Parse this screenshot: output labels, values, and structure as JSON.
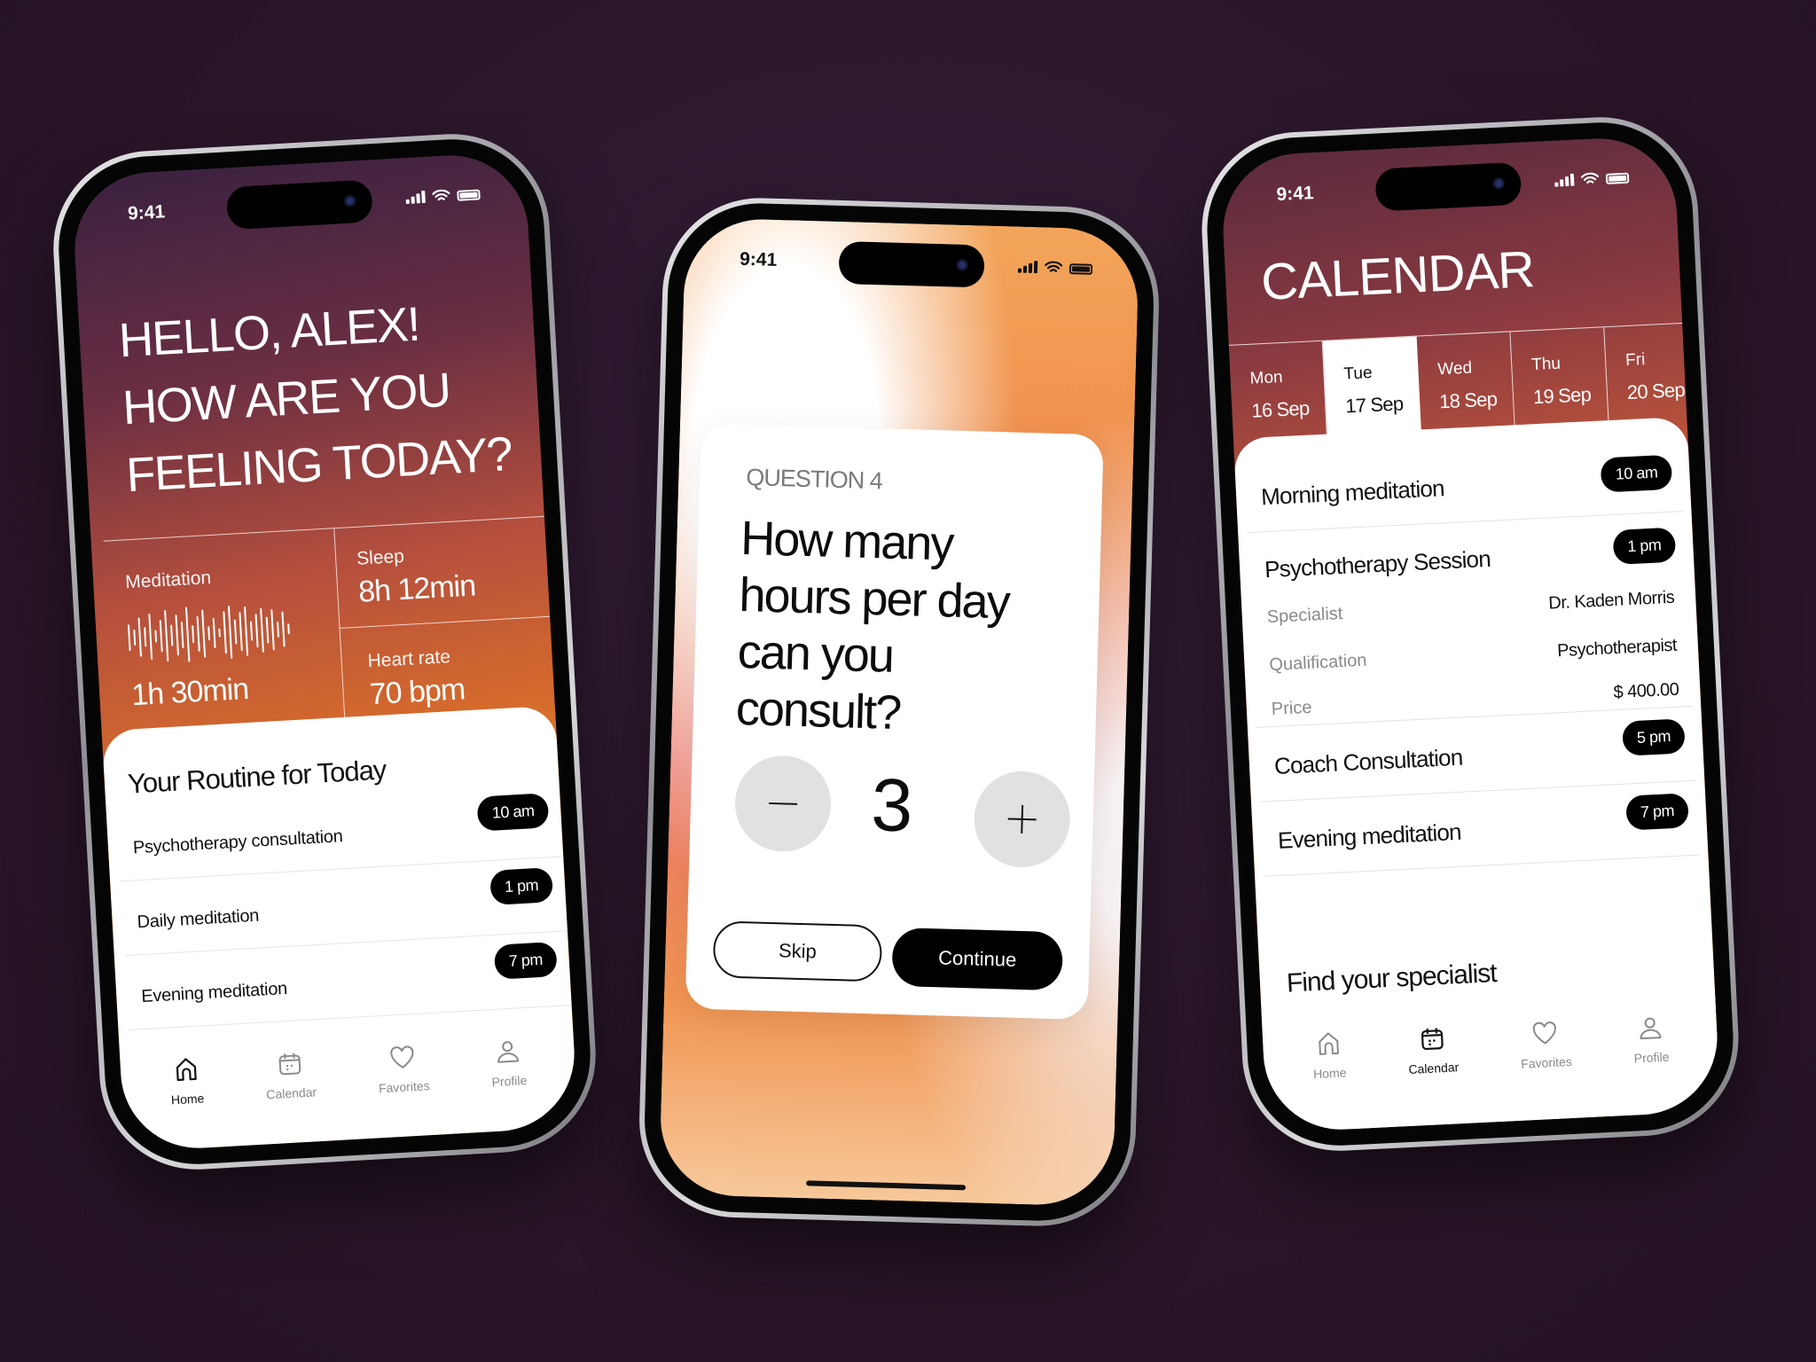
{
  "status_time": "9:41",
  "home": {
    "greeting_lines": [
      "HELLO, ALEX!",
      "HOW ARE YOU",
      "FEELING TODAY?"
    ],
    "stats": {
      "meditation": {
        "label": "Meditation",
        "value": "1h 30min"
      },
      "sleep": {
        "label": "Sleep",
        "value": "8h 12min"
      },
      "heart_rate": {
        "label": "Heart rate",
        "value": "70 bpm"
      }
    },
    "routine_title": "Your Routine for Today",
    "routine": [
      {
        "name": "Psychotherapy consultation",
        "time": "10 am"
      },
      {
        "name": "Daily meditation",
        "time": "1 pm"
      },
      {
        "name": "Evening meditation",
        "time": "7 pm"
      }
    ],
    "active_tab": "Home"
  },
  "quiz": {
    "label": "QUESTION 4",
    "question": "How many hours per day can you consult?",
    "value": "3",
    "skip_label": "Skip",
    "continue_label": "Continue"
  },
  "calendar": {
    "title": "CALENDAR",
    "days": [
      {
        "day": "Mon",
        "date": "16 Sep",
        "selected": false
      },
      {
        "day": "Tue",
        "date": "17 Sep",
        "selected": true
      },
      {
        "day": "Wed",
        "date": "18 Sep",
        "selected": false
      },
      {
        "day": "Thu",
        "date": "19 Sep",
        "selected": false
      },
      {
        "day": "Fri",
        "date": "20 Sep",
        "selected": false
      }
    ],
    "events": [
      {
        "name": "Morning meditation",
        "time": "10 am"
      },
      {
        "name": "Psychotherapy Session",
        "time": "1 pm",
        "details": [
          {
            "key": "Specialist",
            "value": "Dr. Kaden Morris"
          },
          {
            "key": "Qualification",
            "value": "Psychotherapist"
          },
          {
            "key": "Price",
            "value": "$ 400.00"
          }
        ]
      },
      {
        "name": "Coach Consultation",
        "time": "5 pm"
      },
      {
        "name": "Evening meditation",
        "time": "7 pm"
      }
    ],
    "find_title": "Find your specialist",
    "active_tab": "Calendar"
  },
  "tabs": [
    "Home",
    "Calendar",
    "Favorites",
    "Profile"
  ],
  "colors": {
    "background": "#2a1629",
    "pill": "#000000",
    "accent_pink": "#e36a85",
    "orange": "#f0a018"
  }
}
